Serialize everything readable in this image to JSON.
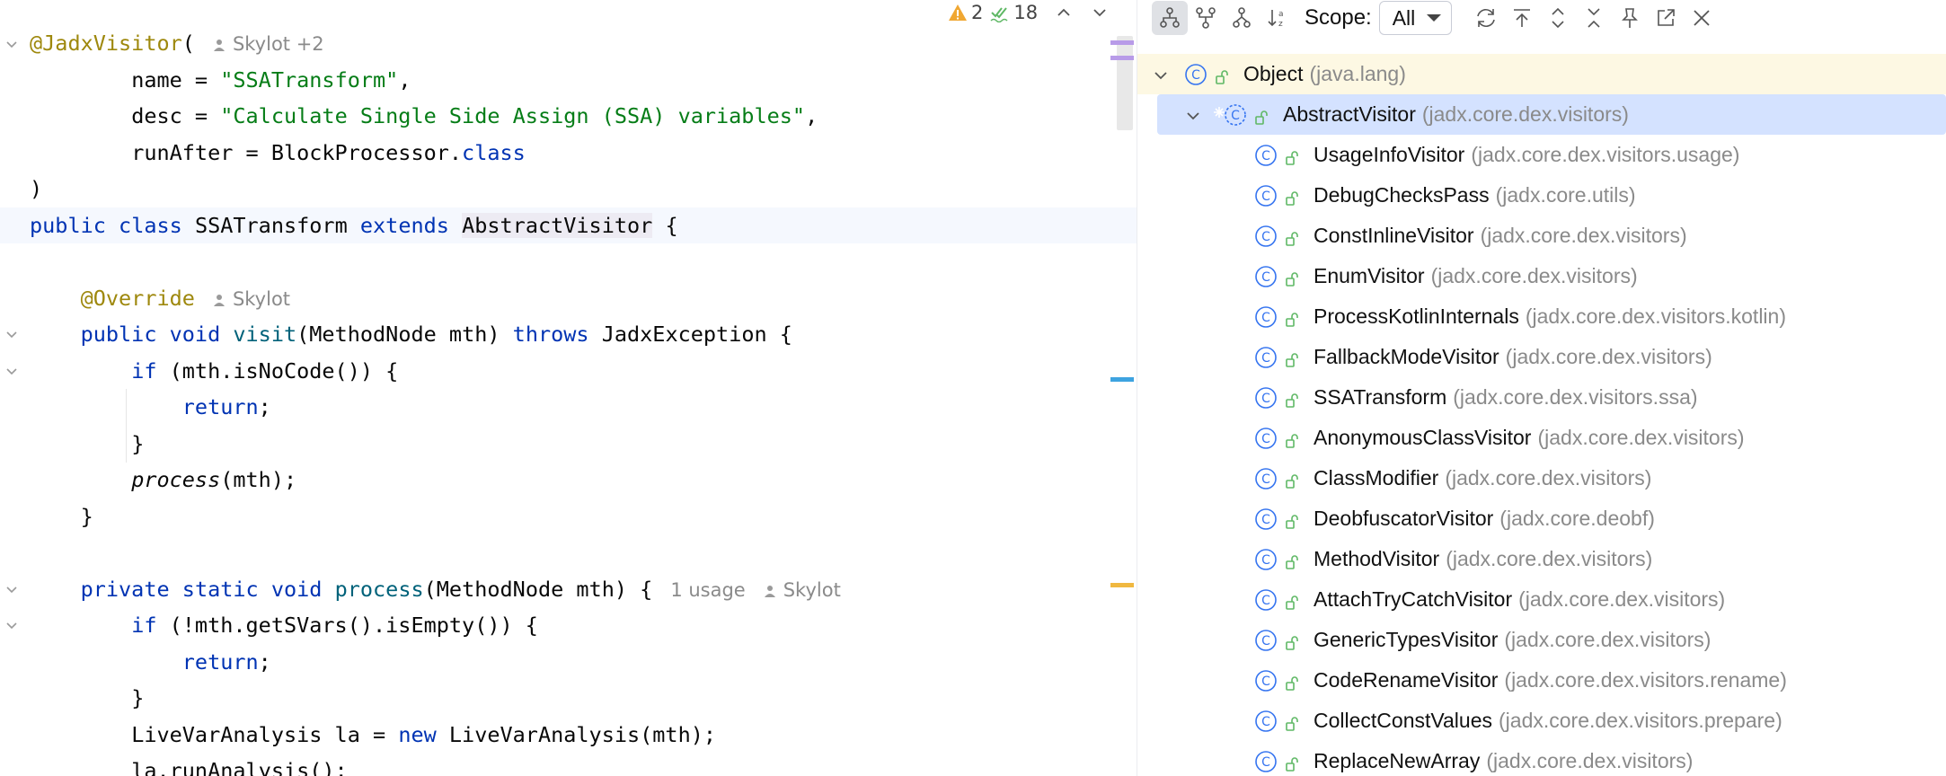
{
  "editor": {
    "inspections": {
      "warnings": "2",
      "checks": "18"
    },
    "code": {
      "ann_jadx": "@JadxVisitor",
      "open_paren": "(",
      "hint_authors_1": "Skylot +2",
      "name_kw": "name = ",
      "name_val": "\"SSATransform\"",
      "comma": ",",
      "desc_kw": "desc = ",
      "desc_val": "\"Calculate Single Side Assign (SSA) variables\"",
      "runafter_kw": "runAfter = BlockProcessor.",
      "class_kw": "class",
      "close_paren": ")",
      "public": "public",
      "class": "class",
      "class_name": " SSATransform ",
      "extends": "extends",
      "abstract_visitor": "AbstractVisitor",
      "brace_open": " {",
      "override": "@Override",
      "hint_authors_2": "Skylot",
      "void": "void",
      "visit": "visit",
      "visit_params": "(MethodNode mth) ",
      "throws": "throws",
      "jadx_exception": " JadxException {",
      "if": "if",
      "if1_cond": " (mth.isNoCode()) {",
      "return": "return",
      "semicolon": ";",
      "brace_close": "}",
      "process_call": "process",
      "process_args": "(mth);",
      "private": "private",
      "static": "static",
      "process_decl": "process",
      "process_params": "(MethodNode mth) {",
      "hint_usage": "1 usage",
      "hint_authors_3": "Skylot",
      "if2_cond": " (!mth.getSVars().isEmpty()) {",
      "lva_decl": "LiveVarAnalysis la = ",
      "new": "new",
      "lva_ctor": " LiveVarAnalysis(mth);",
      "run_analysis": "la.runAnalysis();"
    }
  },
  "hierarchy": {
    "scope_label": "Scope:",
    "scope_value": "All",
    "root": {
      "name": "Object",
      "pkg": "(java.lang)"
    },
    "selected": {
      "name": "AbstractVisitor",
      "pkg": "(jadx.core.dex.visitors)"
    },
    "children": [
      {
        "name": "UsageInfoVisitor",
        "pkg": "(jadx.core.dex.visitors.usage)"
      },
      {
        "name": "DebugChecksPass",
        "pkg": "(jadx.core.utils)"
      },
      {
        "name": "ConstInlineVisitor",
        "pkg": "(jadx.core.dex.visitors)"
      },
      {
        "name": "EnumVisitor",
        "pkg": "(jadx.core.dex.visitors)"
      },
      {
        "name": "ProcessKotlinInternals",
        "pkg": "(jadx.core.dex.visitors.kotlin)"
      },
      {
        "name": "FallbackModeVisitor",
        "pkg": "(jadx.core.dex.visitors)"
      },
      {
        "name": "SSATransform",
        "pkg": "(jadx.core.dex.visitors.ssa)"
      },
      {
        "name": "AnonymousClassVisitor",
        "pkg": "(jadx.core.dex.visitors)"
      },
      {
        "name": "ClassModifier",
        "pkg": "(jadx.core.dex.visitors)"
      },
      {
        "name": "DeobfuscatorVisitor",
        "pkg": "(jadx.core.deobf)"
      },
      {
        "name": "MethodVisitor",
        "pkg": "(jadx.core.dex.visitors)"
      },
      {
        "name": "AttachTryCatchVisitor",
        "pkg": "(jadx.core.dex.visitors)"
      },
      {
        "name": "GenericTypesVisitor",
        "pkg": "(jadx.core.dex.visitors)"
      },
      {
        "name": "CodeRenameVisitor",
        "pkg": "(jadx.core.dex.visitors.rename)"
      },
      {
        "name": "CollectConstValues",
        "pkg": "(jadx.core.dex.visitors.prepare)"
      },
      {
        "name": "ReplaceNewArray",
        "pkg": "(jadx.core.dex.visitors)"
      }
    ]
  },
  "colors": {
    "keyword": "#0033b3",
    "string": "#067d17",
    "annotation": "#9e880d",
    "class_icon": "#3574f0",
    "visibility_icon": "#5fb865",
    "warning": "#f0a732"
  }
}
